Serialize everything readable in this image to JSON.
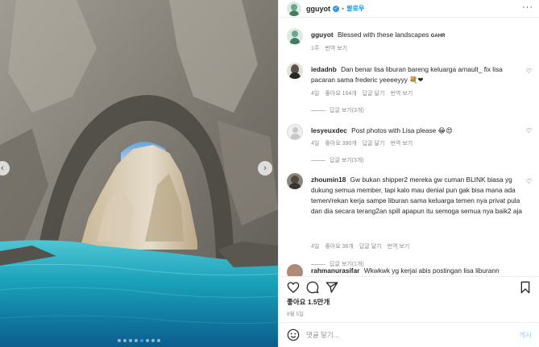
{
  "header": {
    "username": "gguyot",
    "separator": "•",
    "follow_label": "팔로우",
    "more_icon": "more-horizontal-icon"
  },
  "caption": {
    "username": "gguyot",
    "text": "Blessed with these landscapes",
    "tag": "GAHR",
    "time": "1주",
    "translate": "번역 보기"
  },
  "comments": [
    {
      "username": "iedadnb",
      "text": "Dan benar lisa liburan bareng keluarga arnault_ fix lisa pacaran sama frederic yeeeeyyy",
      "emoji": "💐❤",
      "time": "4일",
      "likes": "좋아요 164개",
      "reply": "답글 달기",
      "translate": "번역 보기",
      "view_replies": "답글 보기(3개)"
    },
    {
      "username": "lesyeuxdec",
      "text": "Post photos with Lisa please",
      "emoji": "😂😍",
      "time": "4일",
      "likes": "좋아요 390개",
      "reply": "답글 달기",
      "translate": "번역 보기",
      "view_replies": "답글 보기(3개)"
    },
    {
      "username": "zhoumin18",
      "text": "Gw bukan shipper2 mereka gw cuman BLINK biasa yg dukung semua member, tapi kalo mau denial pun gak bisa mana ada temen/rekan kerja sampe liburan sama keluarga temen nya privat pula dan dia secara terang2an spill apapun itu semoga semua nya baik2 aja",
      "emoji": "",
      "time": "4일",
      "likes": "좋아요 36개",
      "reply": "답글 달기",
      "translate": "번역 보기",
      "view_replies": "답글 보기(1개)"
    },
    {
      "username": "rahmanurasifar",
      "text": "Wkwkwk yg kerjai abis postingan lisa liburann",
      "emoji": "",
      "time": "",
      "likes": "",
      "reply": "",
      "translate": "",
      "view_replies": ""
    }
  ],
  "footer": {
    "likes": "좋아요 1.5만개",
    "date": "8월 5일",
    "comment_placeholder": "댓글 달기...",
    "post_label": "게시"
  },
  "icons": {
    "like": "heart-icon",
    "comment": "comment-icon",
    "share": "send-icon",
    "save": "bookmark-icon",
    "emoji": "emoji-icon"
  },
  "colors": {
    "link_blue": "#0095f6",
    "verified_blue": "#3897f0",
    "muted": "#8e8e8e",
    "water": "#1fa0b8"
  }
}
